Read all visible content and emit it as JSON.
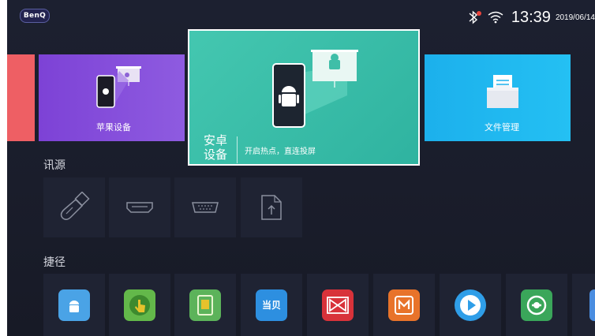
{
  "brand": "BenQ",
  "status": {
    "time": "13:39",
    "date": "2019/06/14",
    "icons": [
      "bluetooth-icon",
      "wifi-icon"
    ]
  },
  "tiles": {
    "apple": {
      "label": "苹果设备"
    },
    "android": {
      "title_line1": "安卓",
      "title_line2": "设备",
      "subtitle": "开启热点，直连投屏"
    },
    "file": {
      "label": "文件管理"
    }
  },
  "sections": {
    "source": "讯源",
    "shortcut": "捷径"
  },
  "source_items": [
    "usb-icon",
    "hdmi-icon",
    "vga-icon",
    "file-upload-icon"
  ],
  "shortcut_items": [
    {
      "icon": "android-app-icon",
      "color": "#4aa3e6"
    },
    {
      "icon": "touch-app-icon",
      "color": "#63b84a"
    },
    {
      "icon": "device-app-icon",
      "color": "#5cb35a"
    },
    {
      "icon": "dangbei-app-icon",
      "color": "#2d8fe0",
      "text": "当贝"
    },
    {
      "icon": "bowtie-app-icon",
      "color": "#d8323a"
    },
    {
      "icon": "mango-app-icon",
      "color": "#e8732a"
    },
    {
      "icon": "play-app-icon",
      "color": "#2f9ee8"
    },
    {
      "icon": "sync-app-icon",
      "color": "#3aa65a"
    },
    {
      "icon": "partial-app-icon",
      "color": "#4a8de0"
    }
  ]
}
